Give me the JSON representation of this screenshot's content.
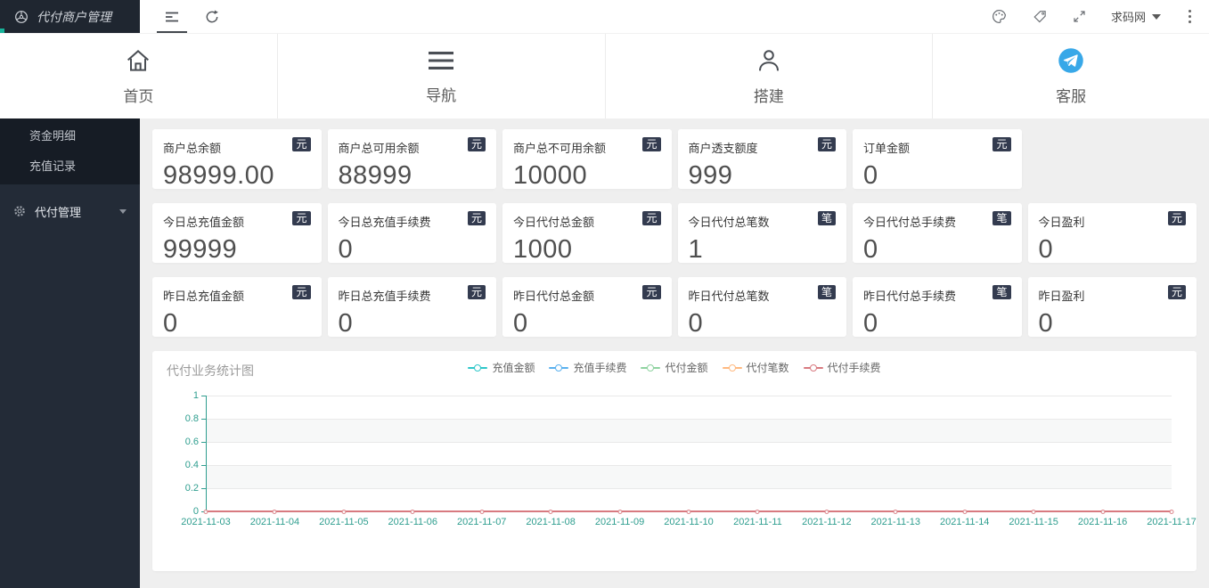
{
  "topbar": {
    "brand": {
      "title": "代付商户管理"
    },
    "user_label": "求码网"
  },
  "nav": {
    "items": [
      {
        "label": "首页",
        "icon": "home-icon"
      },
      {
        "label": "导航",
        "icon": "menu-lines-icon"
      },
      {
        "label": "搭建",
        "icon": "person-icon"
      },
      {
        "label": "客服",
        "icon": "telegram-icon"
      }
    ]
  },
  "sidebar": {
    "submenu": [
      {
        "label": "资金明细"
      },
      {
        "label": "充值记录"
      }
    ],
    "menu": [
      {
        "label": "代付管理",
        "icon": "gear-icon",
        "expanded": false
      }
    ]
  },
  "stats": {
    "rows": [
      {
        "cards": [
          {
            "label": "商户总余额",
            "value": "98999.00",
            "unit": "元"
          },
          {
            "label": "商户总可用余额",
            "value": "88999",
            "unit": "元"
          },
          {
            "label": "商户总不可用余额",
            "value": "10000",
            "unit": "元"
          },
          {
            "label": "商户透支额度",
            "value": "999",
            "unit": "元"
          },
          {
            "label": "订单金额",
            "value": "0",
            "unit": "元"
          }
        ]
      },
      {
        "cards": [
          {
            "label": "今日总充值金额",
            "value": "99999",
            "unit": "元"
          },
          {
            "label": "今日总充值手续费",
            "value": "0",
            "unit": "元"
          },
          {
            "label": "今日代付总金额",
            "value": "1000",
            "unit": "元"
          },
          {
            "label": "今日代付总笔数",
            "value": "1",
            "unit": "笔"
          },
          {
            "label": "今日代付总手续费",
            "value": "0",
            "unit": "笔"
          },
          {
            "label": "今日盈利",
            "value": "0",
            "unit": "元"
          }
        ]
      },
      {
        "cards": [
          {
            "label": "昨日总充值金额",
            "value": "0",
            "unit": "元"
          },
          {
            "label": "昨日总充值手续费",
            "value": "0",
            "unit": "元"
          },
          {
            "label": "昨日代付总金额",
            "value": "0",
            "unit": "元"
          },
          {
            "label": "昨日代付总笔数",
            "value": "0",
            "unit": "笔"
          },
          {
            "label": "昨日代付总手续费",
            "value": "0",
            "unit": "笔"
          },
          {
            "label": "昨日盈利",
            "value": "0",
            "unit": "元"
          }
        ]
      }
    ]
  },
  "chart_data": {
    "type": "line",
    "title": "代付业务统计图",
    "x": [
      "2021-11-03",
      "2021-11-04",
      "2021-11-05",
      "2021-11-06",
      "2021-11-07",
      "2021-11-08",
      "2021-11-09",
      "2021-11-10",
      "2021-11-11",
      "2021-11-12",
      "2021-11-13",
      "2021-11-14",
      "2021-11-15",
      "2021-11-16",
      "2021-11-17"
    ],
    "series": [
      {
        "name": "充值金额",
        "color": "#2ec7c9",
        "values": [
          0,
          0,
          0,
          0,
          0,
          0,
          0,
          0,
          0,
          0,
          0,
          0,
          0,
          0,
          0
        ]
      },
      {
        "name": "充值手续费",
        "color": "#5ab1ef",
        "values": [
          0,
          0,
          0,
          0,
          0,
          0,
          0,
          0,
          0,
          0,
          0,
          0,
          0,
          0,
          0
        ]
      },
      {
        "name": "代付金额",
        "color": "#8fd3a0",
        "values": [
          0,
          0,
          0,
          0,
          0,
          0,
          0,
          0,
          0,
          0,
          0,
          0,
          0,
          0,
          0
        ]
      },
      {
        "name": "代付笔数",
        "color": "#ffb980",
        "values": [
          0,
          0,
          0,
          0,
          0,
          0,
          0,
          0,
          0,
          0,
          0,
          0,
          0,
          0,
          0
        ]
      },
      {
        "name": "代付手续费",
        "color": "#d87a80",
        "values": [
          0,
          0,
          0,
          0,
          0,
          0,
          0,
          0,
          0,
          0,
          0,
          0,
          0,
          0,
          0
        ]
      }
    ],
    "ylim": [
      0,
      1
    ],
    "yticks": [
      0,
      0.2,
      0.4,
      0.6,
      0.8,
      1
    ],
    "xlabel": "",
    "ylabel": "",
    "axis_color": "#2f9e8f",
    "band_color": "#f7f8f8",
    "grid": true,
    "legend_position": "top-center"
  },
  "colors": {
    "badge_bg": "#333b4f",
    "sidebar_bg": "#232b37",
    "brand_bg": "#1f2630",
    "telegram_blue": "#38a8e8",
    "content_bg": "#efefef"
  }
}
